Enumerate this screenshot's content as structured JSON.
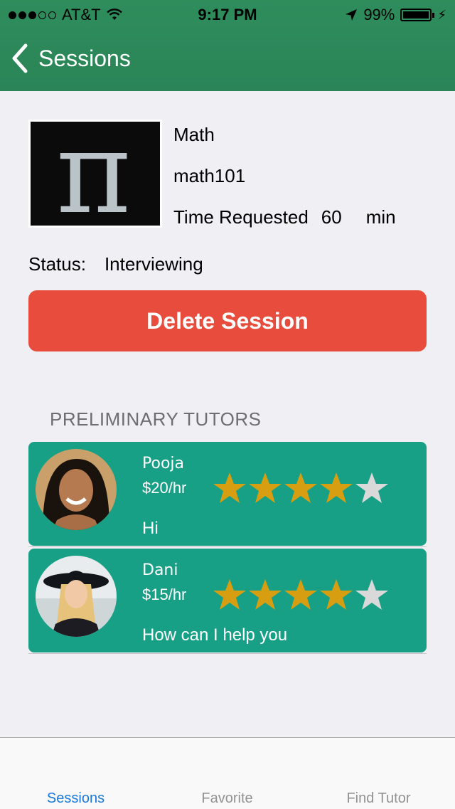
{
  "status_bar": {
    "carrier": "AT&T",
    "signal_dots_filled": 3,
    "signal_dots_total": 5,
    "time": "9:17 PM",
    "battery": "99%"
  },
  "nav": {
    "back_label": "Sessions"
  },
  "session": {
    "subject": "Math",
    "course": "math101",
    "time_label": "Time Requested",
    "time_value": "60",
    "time_unit": "min",
    "status_label": "Status:",
    "status_value": "Interviewing",
    "delete_label": "Delete Session"
  },
  "tutors_section": {
    "title": "PRELIMINARY TUTORS",
    "tutors": [
      {
        "name": "Pooja",
        "rate": "$20/hr",
        "message": "Hi",
        "rating": 4,
        "max_rating": 5
      },
      {
        "name": "Dani",
        "rate": "$15/hr",
        "message": "How can I help you",
        "rating": 4,
        "max_rating": 5
      }
    ]
  },
  "tabbar": {
    "tabs": [
      {
        "label": "Sessions",
        "active": true
      },
      {
        "label": "Favorite",
        "active": false
      },
      {
        "label": "Find Tutor",
        "active": false
      }
    ]
  },
  "colors": {
    "header": "#2f8d5c",
    "delete_button": "#e74c3c",
    "tutor_card": "#17a085",
    "star_filled": "#d69e10",
    "star_empty": "#d9d9d9",
    "tab_active": "#1a78d8"
  },
  "icons": [
    "back-chevron-icon",
    "wifi-icon",
    "location-arrow-icon",
    "battery-icon",
    "star-icon"
  ]
}
